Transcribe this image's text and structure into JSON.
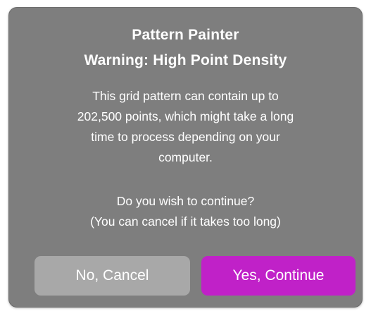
{
  "dialog": {
    "title_line1": "Pattern Painter",
    "title_line2": "Warning: High Point Density",
    "message_lines": [
      "This grid pattern can contain up to",
      "202,500 points, which might take a long",
      "time to process depending on your",
      "computer.",
      "Do you wish to continue?",
      "(You can cancel if it takes too long)"
    ],
    "cancel_label": "No, Cancel",
    "continue_label": "Yes, Continue"
  },
  "colors": {
    "dialog_background": "#7e7e7e",
    "cancel_button": "#a8a8a8",
    "continue_button": "#c021c8",
    "text": "#ffffff"
  }
}
